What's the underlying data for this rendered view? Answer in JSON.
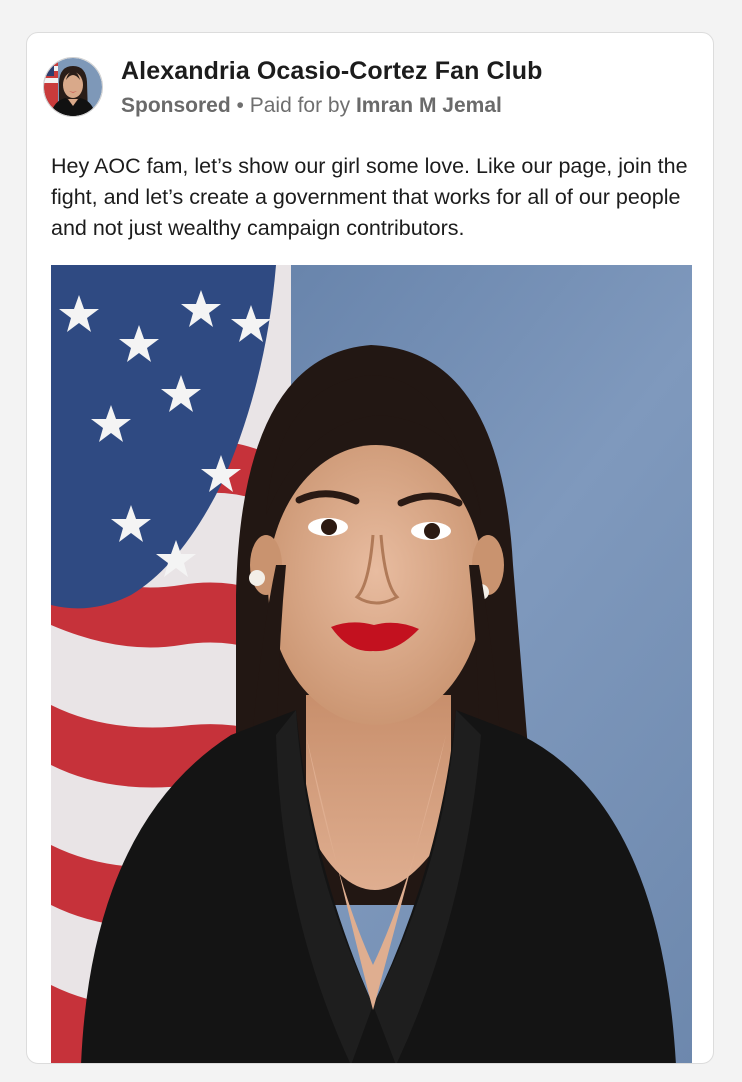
{
  "post": {
    "page_name": "Alexandria Ocasio-Cortez Fan Club",
    "sponsored_label": "Sponsored",
    "separator": " • ",
    "paid_for_prefix": "Paid for by ",
    "paid_for_name": "Imran M Jemal",
    "body_text": "Hey AOC fam, let’s show our girl some love. Like our page, join the fight, and let’s create a government that works for all of our people and not just wealthy campaign contributors."
  },
  "images": {
    "avatar_icon": "profile-photo-icon",
    "post_photo": "portrait-photo"
  },
  "colors": {
    "card_background": "#ffffff",
    "page_background": "#f3f3f3",
    "text_primary": "#1c1c1c",
    "text_secondary": "#6f6f6f"
  }
}
